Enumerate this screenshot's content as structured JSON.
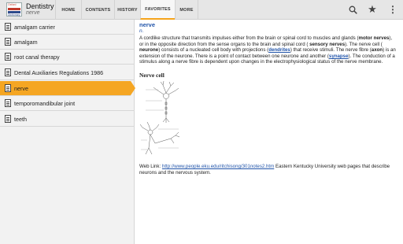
{
  "app": {
    "title": "Dentistry",
    "subtitle": "nerve",
    "logo_top": "Oxford",
    "logo_bottom": "Dictionary"
  },
  "tabs": [
    "HOME",
    "CONTENTS",
    "HISTORY",
    "FAVORITES",
    "MORE"
  ],
  "active_tab": "FAVORITES",
  "actions": {
    "search_icon": "search-icon",
    "star_icon": "star-icon",
    "overflow_icon": "overflow-menu-icon"
  },
  "colors": {
    "accent": "#f5a623",
    "link": "#2255aa"
  },
  "sidebar": {
    "items": [
      {
        "label": "amalgam carrier"
      },
      {
        "label": "amalgam"
      },
      {
        "label": "root canal therapy"
      },
      {
        "label": "Dental Auxiliaries Regulations 1986"
      },
      {
        "label": "nerve",
        "selected": true
      },
      {
        "label": "temporomandibular joint"
      },
      {
        "label": "teeth"
      }
    ]
  },
  "entry": {
    "headword": "nerve",
    "pos": "n.",
    "definition": {
      "t1": "A cordlike structure that transmits impulses either from the brain or spinal cord to muscles and glands (",
      "b1": "motor nerves",
      "t2": "), or in the opposite direction from the sense organs to the brain and spinal cord ( ",
      "b2": "sensory nerves",
      "t3": "). The nerve cell ( ",
      "b3": "neurone",
      "t4": ") consists of a nucleated cell body with projections (",
      "l1": "dendrites",
      "t5": ") that receive stimuli. The nerve fibre (",
      "b4": "axon",
      "t6": ") is an extension of the neurone. There is a point of contact between one neurone and another (",
      "l2": "synapse",
      "t7": "). The conduction of a stimulus along a nerve fibre is dependent upon changes in the electrophysiological status of the nerve membrane."
    },
    "figure_title": "Nerve cell",
    "weblink": {
      "prefix": "Web Link: ",
      "url": "http://www.people.eku.edu/ritchisong/301notes2.htm",
      "suffix": " Eastern Kentucky University web pages that describe neurons and the nervous system."
    }
  }
}
